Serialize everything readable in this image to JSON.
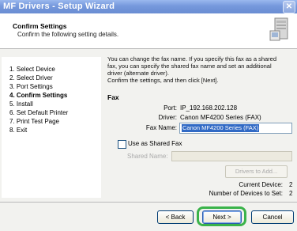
{
  "window": {
    "title": "MF Drivers - Setup Wizard",
    "close_glyph": "✕"
  },
  "header": {
    "title": "Confirm Settings",
    "subtitle": "Confirm the following setting details.",
    "icon": "computer-install-icon"
  },
  "steps": [
    {
      "label": "1.  Select Device",
      "active": false
    },
    {
      "label": "2.  Select Driver",
      "active": false
    },
    {
      "label": "3.  Port Settings",
      "active": false
    },
    {
      "label": "4.  Confirm Settings",
      "active": true
    },
    {
      "label": "5.  Install",
      "active": false
    },
    {
      "label": "6.  Set Default Printer",
      "active": false
    },
    {
      "label": "7.  Print Test Page",
      "active": false
    },
    {
      "label": "8.  Exit",
      "active": false
    }
  ],
  "content": {
    "description_lines": [
      "You can change the fax name. If you specify this fax as a shared",
      "fax, you can specify the shared fax name and set an additional",
      "driver (alternate driver).",
      "Confirm the settings, and then click [Next]."
    ],
    "fax_heading": "Fax",
    "port_label": "Port:",
    "port_value": "IP_192.168.202.128",
    "driver_label": "Driver:",
    "driver_value": "Canon MF4200 Series (FAX)",
    "fax_name_label": "Fax Name:",
    "fax_name_value": "Canon MF4200 Series (FAX)",
    "use_shared_label": "Use as Shared Fax",
    "use_shared_checked": false,
    "shared_name_label": "Shared Name:",
    "shared_name_value": "",
    "drivers_button": "Drivers to Add...",
    "current_device_label": "Current Device:",
    "current_device_value": "2",
    "devices_to_set_label": "Number of Devices to Set:",
    "devices_to_set_value": "2"
  },
  "footer": {
    "back_label": "< Back",
    "next_label": "Next >",
    "cancel_label": "Cancel",
    "highlight_color": "#3ab34a"
  }
}
